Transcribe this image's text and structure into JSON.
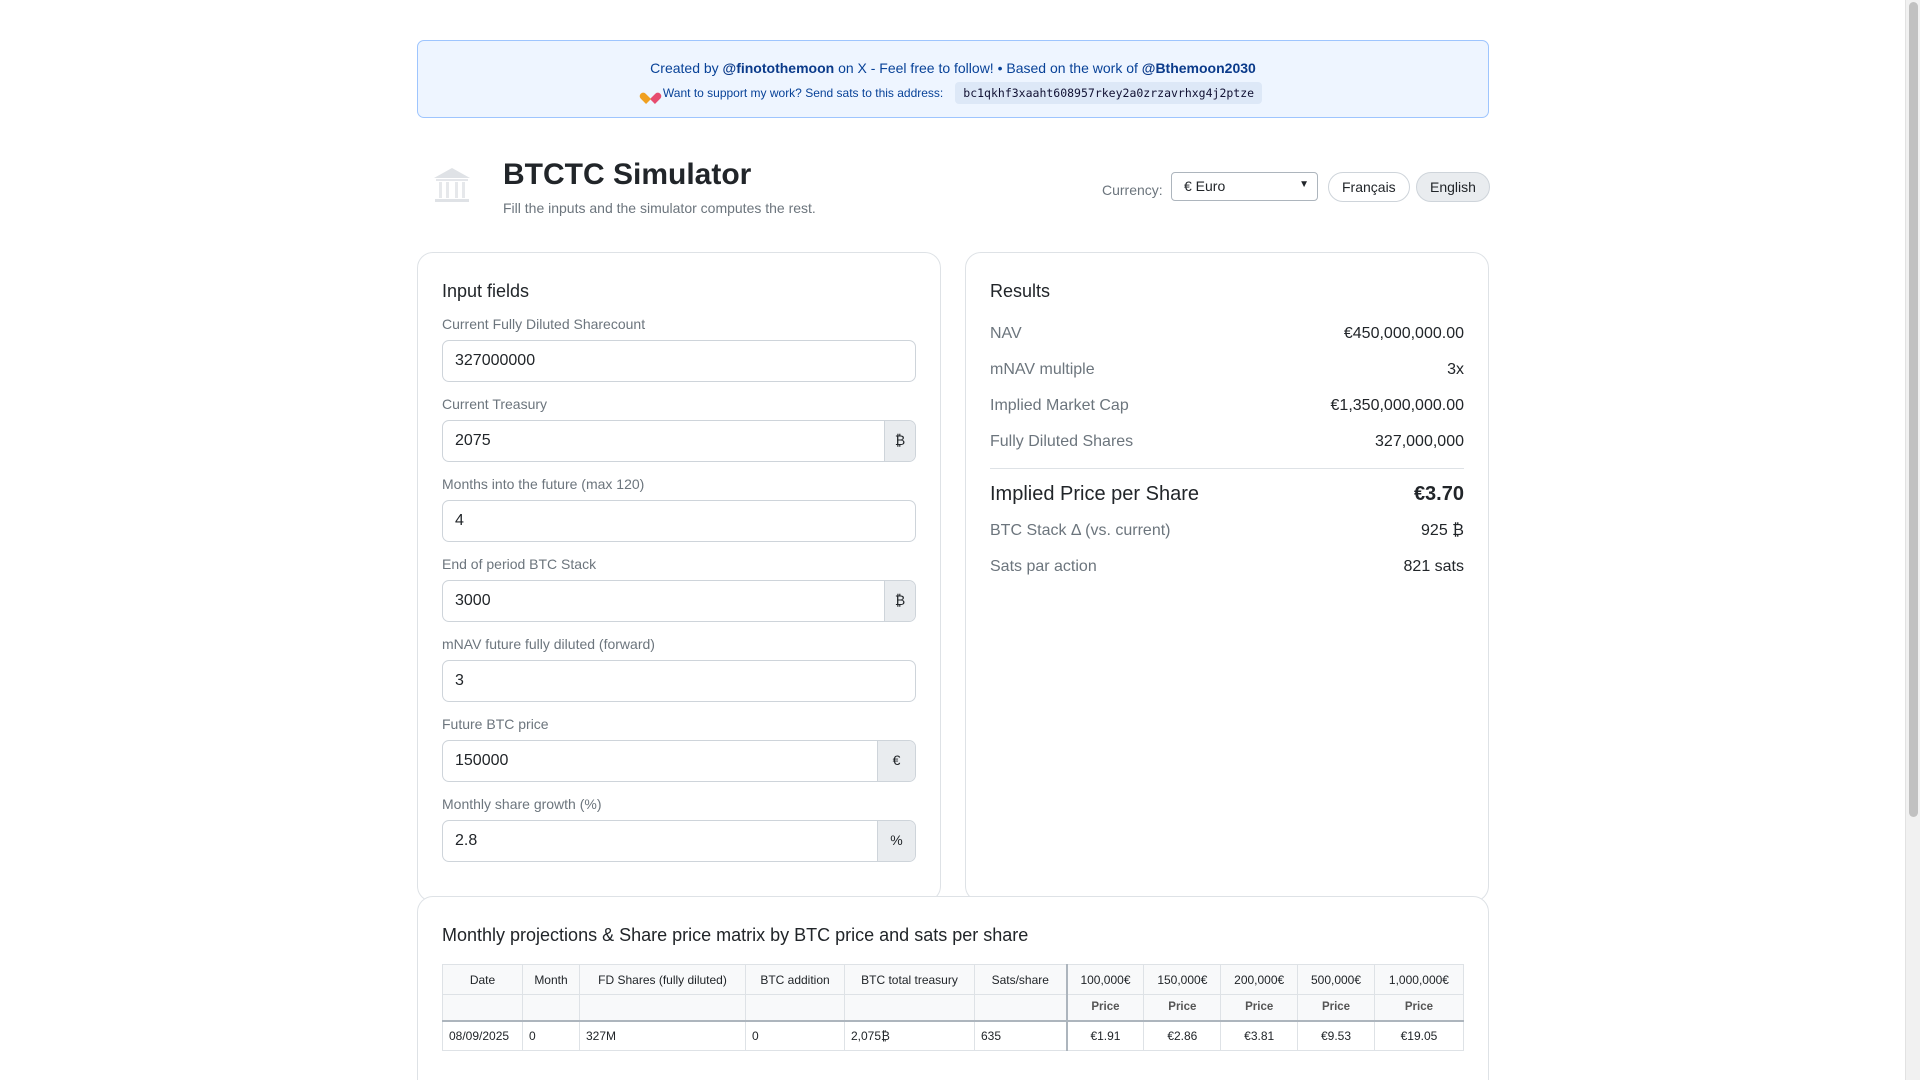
{
  "banner": {
    "prefix": "Created by",
    "author1": "@finotothemoon",
    "middle": "on X - Feel free to follow! • Based on the work of",
    "author2": "@Bthemoon2030",
    "support_text": "Want to support my work? Send sats to this address:",
    "address": "bc1qkhf3xaaht608957rkey2a0zrzavrhxg4j2ptze"
  },
  "header": {
    "title": "BTCTC Simulator",
    "subtitle": "Fill the inputs and the simulator computes the rest.",
    "currency_label": "Currency:",
    "currency_value": "€ Euro",
    "lang_fr": "Français",
    "lang_en": "English"
  },
  "inputs": {
    "title": "Input fields",
    "fields": [
      {
        "label": "Current Fully Diluted Sharecount",
        "value": "327000000",
        "suffix": ""
      },
      {
        "label": "Current Treasury",
        "value": "2075",
        "suffix": "₿"
      },
      {
        "label": "Months into the future (max 120)",
        "value": "4",
        "suffix": ""
      },
      {
        "label": "End of period BTC Stack",
        "value": "3000",
        "suffix": "₿"
      },
      {
        "label": "mNAV future fully diluted (forward)",
        "value": "3",
        "suffix": ""
      },
      {
        "label": "Future BTC price",
        "value": "150000",
        "suffix": "€"
      },
      {
        "label": "Monthly share growth (%)",
        "value": "2.8",
        "suffix": "%"
      }
    ]
  },
  "results": {
    "title": "Results",
    "rows": [
      {
        "key": "NAV",
        "value": "€450,000,000.00"
      },
      {
        "key": "mNAV multiple",
        "value": "3x"
      },
      {
        "key": "Implied Market Cap",
        "value": "€1,350,000,000.00"
      },
      {
        "key": "Fully Diluted Shares",
        "value": "327,000,000"
      }
    ],
    "main": {
      "key": "Implied Price per Share",
      "value": "€3.70"
    },
    "extra": [
      {
        "key": "BTC Stack Δ (vs. current)",
        "value": "925 ₿"
      },
      {
        "key": "Sats par action",
        "value": "821 sats"
      }
    ]
  },
  "projections": {
    "title": "Monthly projections & Share price matrix by BTC price and sats per share",
    "headers": [
      "Date",
      "Month",
      "FD Shares (fully diluted)",
      "BTC addition",
      "BTC total treasury",
      "Sats/share"
    ],
    "price_headers": [
      "100,000€",
      "150,000€",
      "200,000€",
      "500,000€",
      "1,000,000€"
    ],
    "sub_label": "Price",
    "rows": [
      {
        "cells": [
          "08/09/2025",
          "0",
          "327M",
          "0",
          "2,075₿",
          "635"
        ],
        "prices": [
          "€1.91",
          "€2.86",
          "€3.81",
          "€9.53",
          "€19.05"
        ]
      }
    ]
  }
}
